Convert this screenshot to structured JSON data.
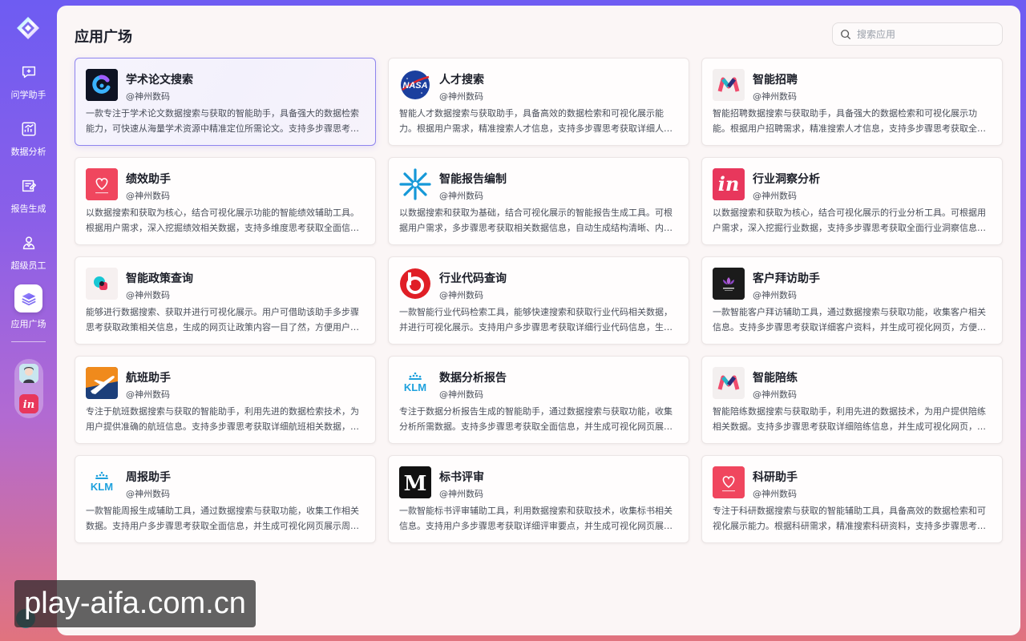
{
  "sidebar": {
    "items": [
      {
        "label": "问学助手",
        "icon": "chat-plus-icon"
      },
      {
        "label": "数据分析",
        "icon": "chart-icon"
      },
      {
        "label": "报告生成",
        "icon": "report-icon"
      },
      {
        "label": "超级员工",
        "icon": "users-icon"
      },
      {
        "label": "应用广场",
        "icon": "layers-icon",
        "active": true
      }
    ]
  },
  "main": {
    "title": "应用广场",
    "search": {
      "placeholder": "搜索应用",
      "value": ""
    }
  },
  "apps": [
    {
      "title": "学术论文搜索",
      "org": "@神州数码",
      "desc": "一款专注于学术论文数据搜索与获取的智能助手，具备强大的数据检索能力，可快速从海量学术资源中精准定位所需论文。支持多步骤思考获取详细论文信息。"
    },
    {
      "title": "人才搜索",
      "org": "@神州数码",
      "desc": "智能人才数据搜索与获取助手，具备高效的数据检索和可视化展示能力。根据用户需求，精准搜索人才信息，支持多步骤思考获取详细人才资料。"
    },
    {
      "title": "智能招聘",
      "org": "@神州数码",
      "desc": "智能招聘数据搜索与获取助手，具备强大的数据检索和可视化展示功能。根据用户招聘需求，精准搜索人才信息，支持多步骤思考获取全面人才信息。"
    },
    {
      "title": "绩效助手",
      "org": "@神州数码",
      "desc": "以数据搜索和获取为核心，结合可视化展示功能的智能绩效辅助工具。根据用户需求，深入挖掘绩效相关数据，支持多维度思考获取全面信息，并生成可视化网页。"
    },
    {
      "title": "智能报告编制",
      "org": "@神州数码",
      "desc": "以数据搜索和获取为基础，结合可视化展示的智能报告生成工具。可根据用户需求，多步骤思考获取相关数据信息，自动生成结构清晰、内容丰富的报告。"
    },
    {
      "title": "行业洞察分析",
      "org": "@神州数码",
      "desc": "以数据搜索和获取为核心，结合可视化展示的行业分析工具。可根据用户需求，深入挖掘行业数据，支持多步骤思考获取全面行业洞察信息，并生成可视化网页。"
    },
    {
      "title": "智能政策查询",
      "org": "@神州数码",
      "desc": "能够进行数据搜索、获取并进行可视化展示。用户可借助该助手多步骤思考获取政策相关信息，生成的网页让政策内容一目了然，方便用户快速理解。"
    },
    {
      "title": "行业代码查询",
      "org": "@神州数码",
      "desc": "一款智能行业代码检索工具，能够快速搜索和获取行业代码相关数据，并进行可视化展示。支持用户多步骤思考获取详细行业代码信息，生成的网页清晰直观。"
    },
    {
      "title": "客户拜访助手",
      "org": "@神州数码",
      "desc": "一款智能客户拜访辅助工具，通过数据搜索与获取功能，收集客户相关信息。支持多步骤思考获取详细客户资料，并生成可视化网页，方便业务人员使用。"
    },
    {
      "title": "航班助手",
      "org": "@神州数码",
      "desc": "专注于航班数据搜索与获取的智能助手，利用先进的数据检索技术，为用户提供准确的航班信息。支持多步骤思考获取详细航班相关数据，并生成可视化网页。"
    },
    {
      "title": "数据分析报告",
      "org": "@神州数码",
      "desc": "专注于数据分析报告生成的智能助手，通过数据搜索与获取功能，收集分析所需数据。支持多步骤思考获取全面信息，并生成可视化网页展示数据分析结果。"
    },
    {
      "title": "智能陪练",
      "org": "@神州数码",
      "desc": "智能陪练数据搜索与获取助手，利用先进的数据技术，为用户提供陪练相关数据。支持多步骤思考获取详细陪练信息，并生成可视化网页，帮助用户提升能力。"
    },
    {
      "title": "周报助手",
      "org": "@神州数码",
      "desc": "一款智能周报生成辅助工具，通过数据搜索与获取功能，收集工作相关数据。支持用户多步骤思考获取全面信息，并生成可视化网页展示周报内容。"
    },
    {
      "title": "标书评审",
      "org": "@神州数码",
      "desc": "一款智能标书评审辅助工具，利用数据搜索和获取技术，收集标书相关信息。支持用户多步骤思考获取详细评审要点，并生成可视化网页展示评审结果。"
    },
    {
      "title": "科研助手",
      "org": "@神州数码",
      "desc": "专注于科研数据搜索与获取的智能辅助工具，具备高效的数据检索和可视化展示能力。根据科研需求，精准搜索科研资料，支持多步骤思考获取详细信息。"
    }
  ],
  "watermark": "play-aifa.com.cn",
  "colors": {
    "accent": "#6e5cf2",
    "selected_border": "#8f85ee",
    "panel_bg": "#fbf6f6"
  }
}
